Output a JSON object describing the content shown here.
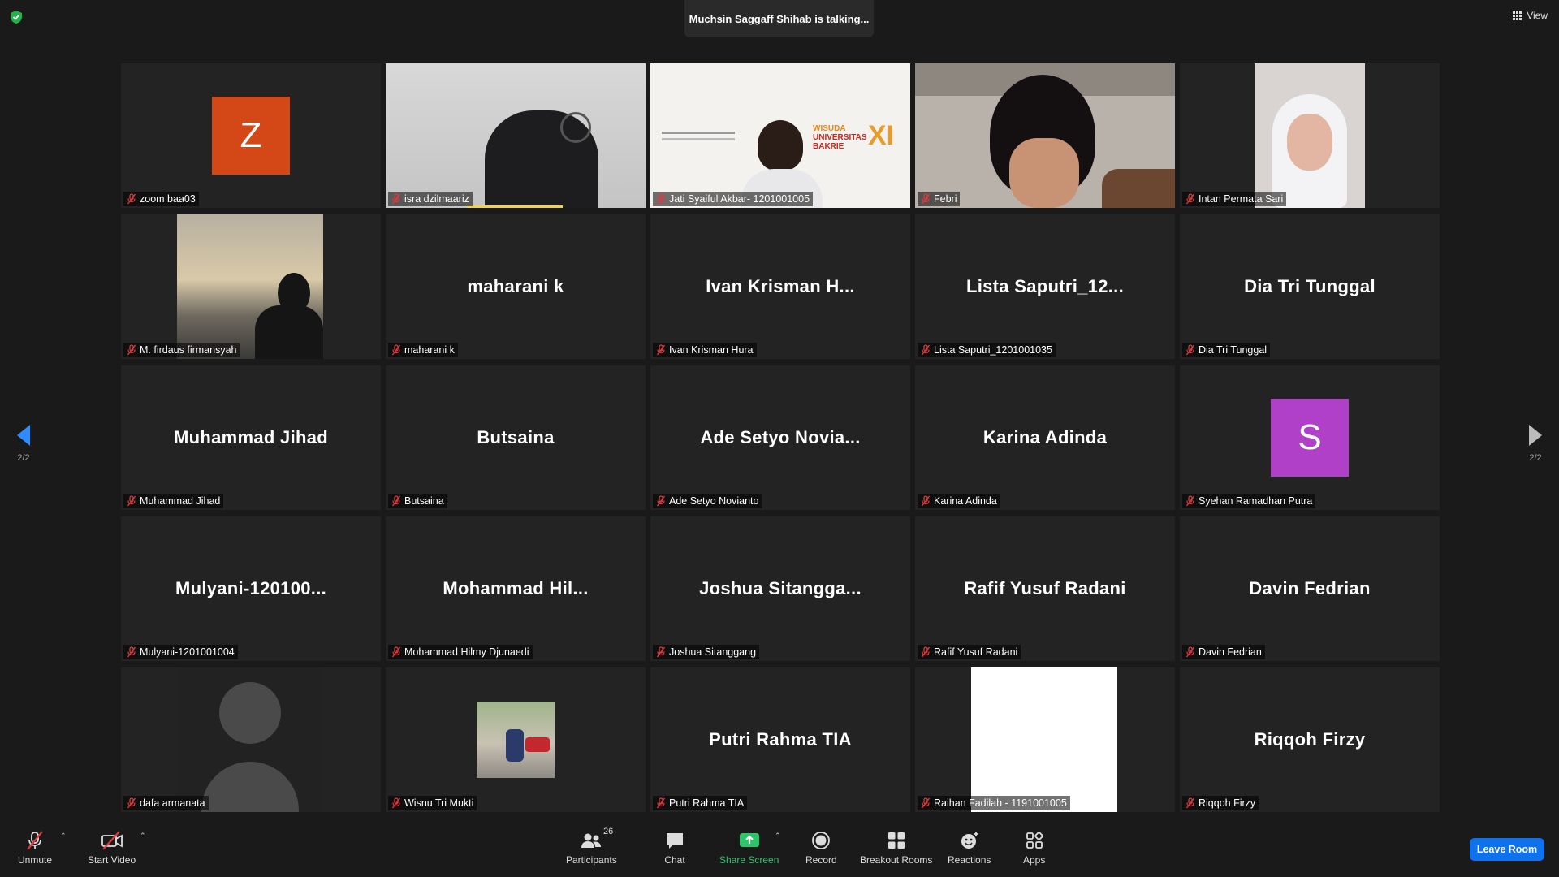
{
  "header": {
    "talking": "Muchsin Saggaff Shihab is talking...",
    "view_label": "View"
  },
  "nav": {
    "page_left": "2/2",
    "page_right": "2/2"
  },
  "participants": [
    {
      "label": "zoom baa03",
      "center": "",
      "type": "avatar",
      "letter": "Z",
      "color": "#d44818"
    },
    {
      "label": "isra dzilmaariz",
      "center": "",
      "type": "video"
    },
    {
      "label": "Jati Syaiful Akbar- 1201001005",
      "center": "",
      "type": "video"
    },
    {
      "label": "Febri",
      "center": "",
      "type": "video"
    },
    {
      "label": "Intan Permata Sari",
      "center": "",
      "type": "video"
    },
    {
      "label": "M. firdaus firmansyah",
      "center": "",
      "type": "photo"
    },
    {
      "label": "maharani k",
      "center": "maharani k",
      "type": "name"
    },
    {
      "label": "Ivan Krisman  Hura",
      "center": "Ivan Krisman  H...",
      "type": "name"
    },
    {
      "label": "Lista Saputri_1201001035",
      "center": "Lista Saputri_12...",
      "type": "name"
    },
    {
      "label": "Dia Tri Tunggal",
      "center": "Dia Tri Tunggal",
      "type": "name"
    },
    {
      "label": "Muhammad Jihad",
      "center": "Muhammad Jihad",
      "type": "name"
    },
    {
      "label": "Butsaina",
      "center": "Butsaina",
      "type": "name"
    },
    {
      "label": "Ade Setyo Novianto",
      "center": "Ade Setyo Novia...",
      "type": "name"
    },
    {
      "label": "Karina Adinda",
      "center": "Karina Adinda",
      "type": "name"
    },
    {
      "label": "Syehan Ramadhan Putra",
      "center": "",
      "type": "avatar",
      "letter": "S",
      "color": "#b040c8"
    },
    {
      "label": "Mulyani-1201001004",
      "center": "Mulyani-120100...",
      "type": "name"
    },
    {
      "label": "Mohammad Hilmy Djunaedi",
      "center": "Mohammad  Hil...",
      "type": "name"
    },
    {
      "label": "Joshua Sitanggang",
      "center": "Joshua  Sitangga...",
      "type": "name"
    },
    {
      "label": "Rafif Yusuf Radani",
      "center": "Rafif Yusuf Radani",
      "type": "name"
    },
    {
      "label": "Davin Fedrian",
      "center": "Davin Fedrian",
      "type": "name"
    },
    {
      "label": "dafa armanata",
      "center": "",
      "type": "silhouette"
    },
    {
      "label": "Wisnu Tri Mukti",
      "center": "",
      "type": "photo"
    },
    {
      "label": "Putri Rahma TIA",
      "center": "Putri Rahma TIA",
      "type": "name"
    },
    {
      "label": "Raihan Fadilah - 1191001005",
      "center": "",
      "type": "white"
    },
    {
      "label": "Riqqoh Firzy",
      "center": "Riqqoh Firzy",
      "type": "name"
    }
  ],
  "toolbar": {
    "unmute": "Unmute",
    "start_video": "Start Video",
    "participants": "Participants",
    "participant_count": "26",
    "chat": "Chat",
    "share_screen": "Share Screen",
    "record": "Record",
    "breakout_rooms": "Breakout Rooms",
    "reactions": "Reactions",
    "apps": "Apps",
    "leave": "Leave Room"
  },
  "colors": {
    "share_green": "#2ec46a",
    "leave_blue": "#0e72ed",
    "muted_red": "#e0393e",
    "speaking": "#f3d34a"
  }
}
